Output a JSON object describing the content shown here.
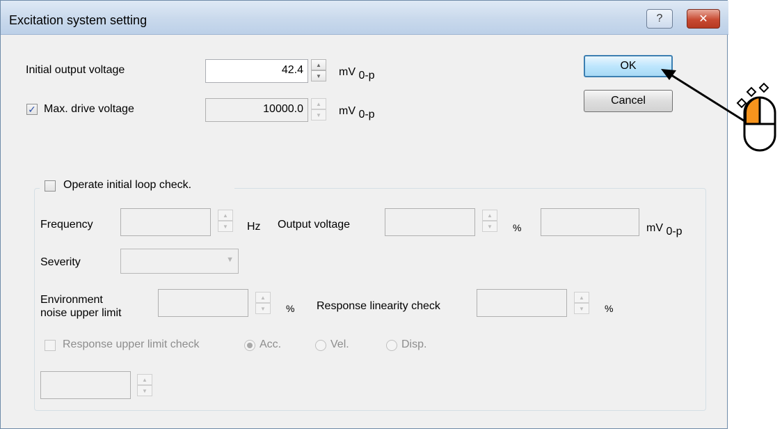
{
  "dialog": {
    "title": "Excitation system setting",
    "help_glyph": "?",
    "close_glyph": "✕"
  },
  "buttons": {
    "ok": "OK",
    "cancel": "Cancel"
  },
  "spin_glyphs": {
    "up": "▲",
    "down": "▼"
  },
  "initial_output": {
    "label": "Initial output voltage",
    "value": "42.4",
    "unit": "mV",
    "unit_sub": "0-p"
  },
  "max_drive": {
    "label": "Max. drive voltage",
    "checked": true,
    "value": "10000.0",
    "unit": "mV",
    "unit_sub": "0-p"
  },
  "loop_check": {
    "label": "Operate initial loop check.",
    "checked": false,
    "frequency": {
      "label": "Frequency",
      "value": "",
      "unit": "Hz"
    },
    "output_voltage": {
      "label": "Output voltage",
      "value": "",
      "unit_pct": "%",
      "value_mv": "",
      "unit": "mV",
      "unit_sub": "0-p"
    },
    "severity": {
      "label": "Severity",
      "value": ""
    },
    "env_noise": {
      "label_line1": "Environment",
      "label_line2": "noise upper limit",
      "value": "",
      "unit": "%"
    },
    "resp_linearity": {
      "label": "Response linearity check",
      "value": "",
      "unit": "%"
    },
    "resp_upper": {
      "label": "Response upper limit check",
      "checked": false,
      "value": ""
    },
    "radios": {
      "acc": "Acc.",
      "vel": "Vel.",
      "disp": "Disp.",
      "selected": "Acc."
    }
  },
  "colors": {
    "accent": "#3c7fb1",
    "cursor_orange": "#f7941d"
  }
}
